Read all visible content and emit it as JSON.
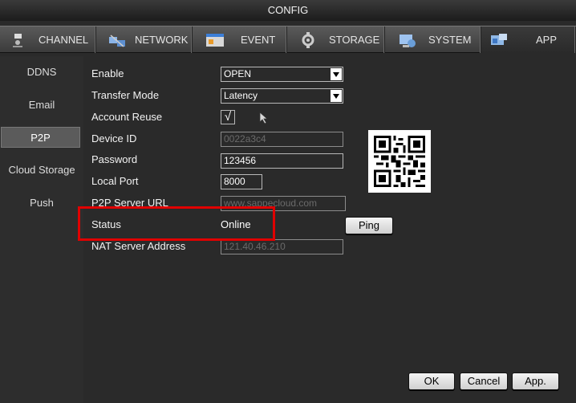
{
  "window": {
    "title": "CONFIG"
  },
  "tabs": [
    {
      "label": "CHANNEL",
      "icon": "camera-icon"
    },
    {
      "label": "NETWORK",
      "icon": "network-icon"
    },
    {
      "label": "EVENT",
      "icon": "event-icon"
    },
    {
      "label": "STORAGE",
      "icon": "storage-icon"
    },
    {
      "label": "SYSTEM",
      "icon": "system-icon"
    },
    {
      "label": "APP",
      "icon": "app-icon"
    }
  ],
  "sidebar": {
    "items": [
      {
        "label": "DDNS"
      },
      {
        "label": "Email"
      },
      {
        "label": "P2P"
      },
      {
        "label": "Cloud Storage"
      },
      {
        "label": "Push"
      }
    ],
    "active": "P2P"
  },
  "form": {
    "enable": {
      "label": "Enable",
      "value": "OPEN"
    },
    "transfer_mode": {
      "label": "Transfer Mode",
      "value": "Latency"
    },
    "account_reuse": {
      "label": "Account Reuse",
      "check": "√"
    },
    "device_id": {
      "label": "Device ID",
      "value": "0022a3c4"
    },
    "password": {
      "label": "Password",
      "value": "123456"
    },
    "local_port": {
      "label": "Local Port",
      "value": "8000"
    },
    "server_url": {
      "label": "P2P Server URL",
      "value": "www.sappecloud.com"
    },
    "status": {
      "label": "Status",
      "value": "Online"
    },
    "nat_address": {
      "label": "NAT Server Address",
      "value": "121.40.46.210"
    }
  },
  "buttons": {
    "ping": "Ping",
    "ok": "OK",
    "cancel": "Cancel",
    "apply": "App."
  },
  "colors": {
    "highlight": "#e00000",
    "qr_background": "#ffffff"
  }
}
